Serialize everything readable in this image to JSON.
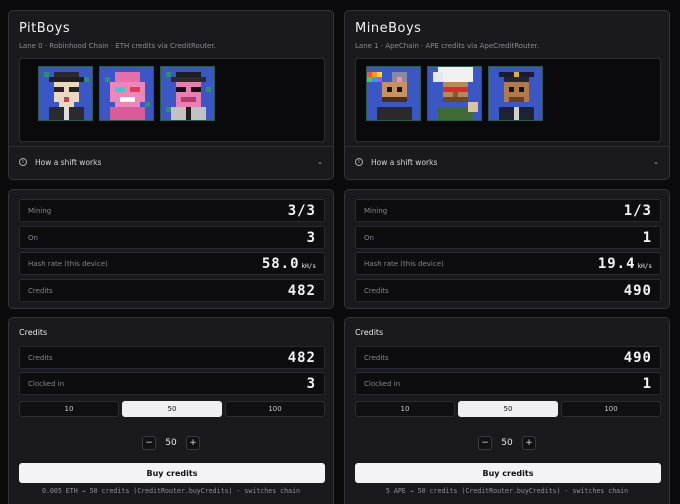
{
  "lanes": [
    {
      "title": "PitBoys",
      "subtitle": "Lane 0 · Robinhood Chain · ETH credits via CreditRouter.",
      "shift_label": "How a shift works",
      "stats": {
        "mining_label": "Mining",
        "mining_value": "3/3",
        "on_label": "On",
        "on_value": "3",
        "hash_label": "Hash rate (this device)",
        "hash_value": "58.0",
        "hash_unit": "kH/s",
        "credits_label": "Credits",
        "credits_value": "482"
      },
      "buy": {
        "title": "Credits",
        "credits_label": "Credits",
        "credits_value": "482",
        "clocked_label": "Clocked in",
        "clocked_value": "3",
        "options": [
          "10",
          "50",
          "100"
        ],
        "selected_option": "50",
        "stepper_minus": "−",
        "stepper_value": "50",
        "stepper_plus": "+",
        "button_label": "Buy credits",
        "note": "0.005 ETH → 50 credits (CreditRouter.buyCredits) · switches chain"
      }
    },
    {
      "title": "MineBoys",
      "subtitle": "Lane 1 · ApeChain · APE credits via ApeCreditRouter.",
      "shift_label": "How a shift works",
      "stats": {
        "mining_label": "Mining",
        "mining_value": "1/3",
        "on_label": "On",
        "on_value": "1",
        "hash_label": "Hash rate (this device)",
        "hash_value": "19.4",
        "hash_unit": "kH/s",
        "credits_label": "Credits",
        "credits_value": "490"
      },
      "buy": {
        "title": "Credits",
        "credits_label": "Credits",
        "credits_value": "490",
        "clocked_label": "Clocked in",
        "clocked_value": "1",
        "options": [
          "10",
          "50",
          "100"
        ],
        "selected_option": "50",
        "stepper_minus": "−",
        "stepper_value": "50",
        "stepper_plus": "+",
        "button_label": "Buy credits",
        "note": "5 APE → 50 credits (CreditRouter.buyCredits) · switches chain"
      }
    }
  ],
  "icons": {
    "info": "info-icon",
    "chevron": "chevron-down-icon"
  },
  "colors": {
    "accent_light": "#efeff2",
    "panel": "#1a1a1e",
    "background": "#0b0b0d",
    "nft_blue": "#3a56c8"
  }
}
